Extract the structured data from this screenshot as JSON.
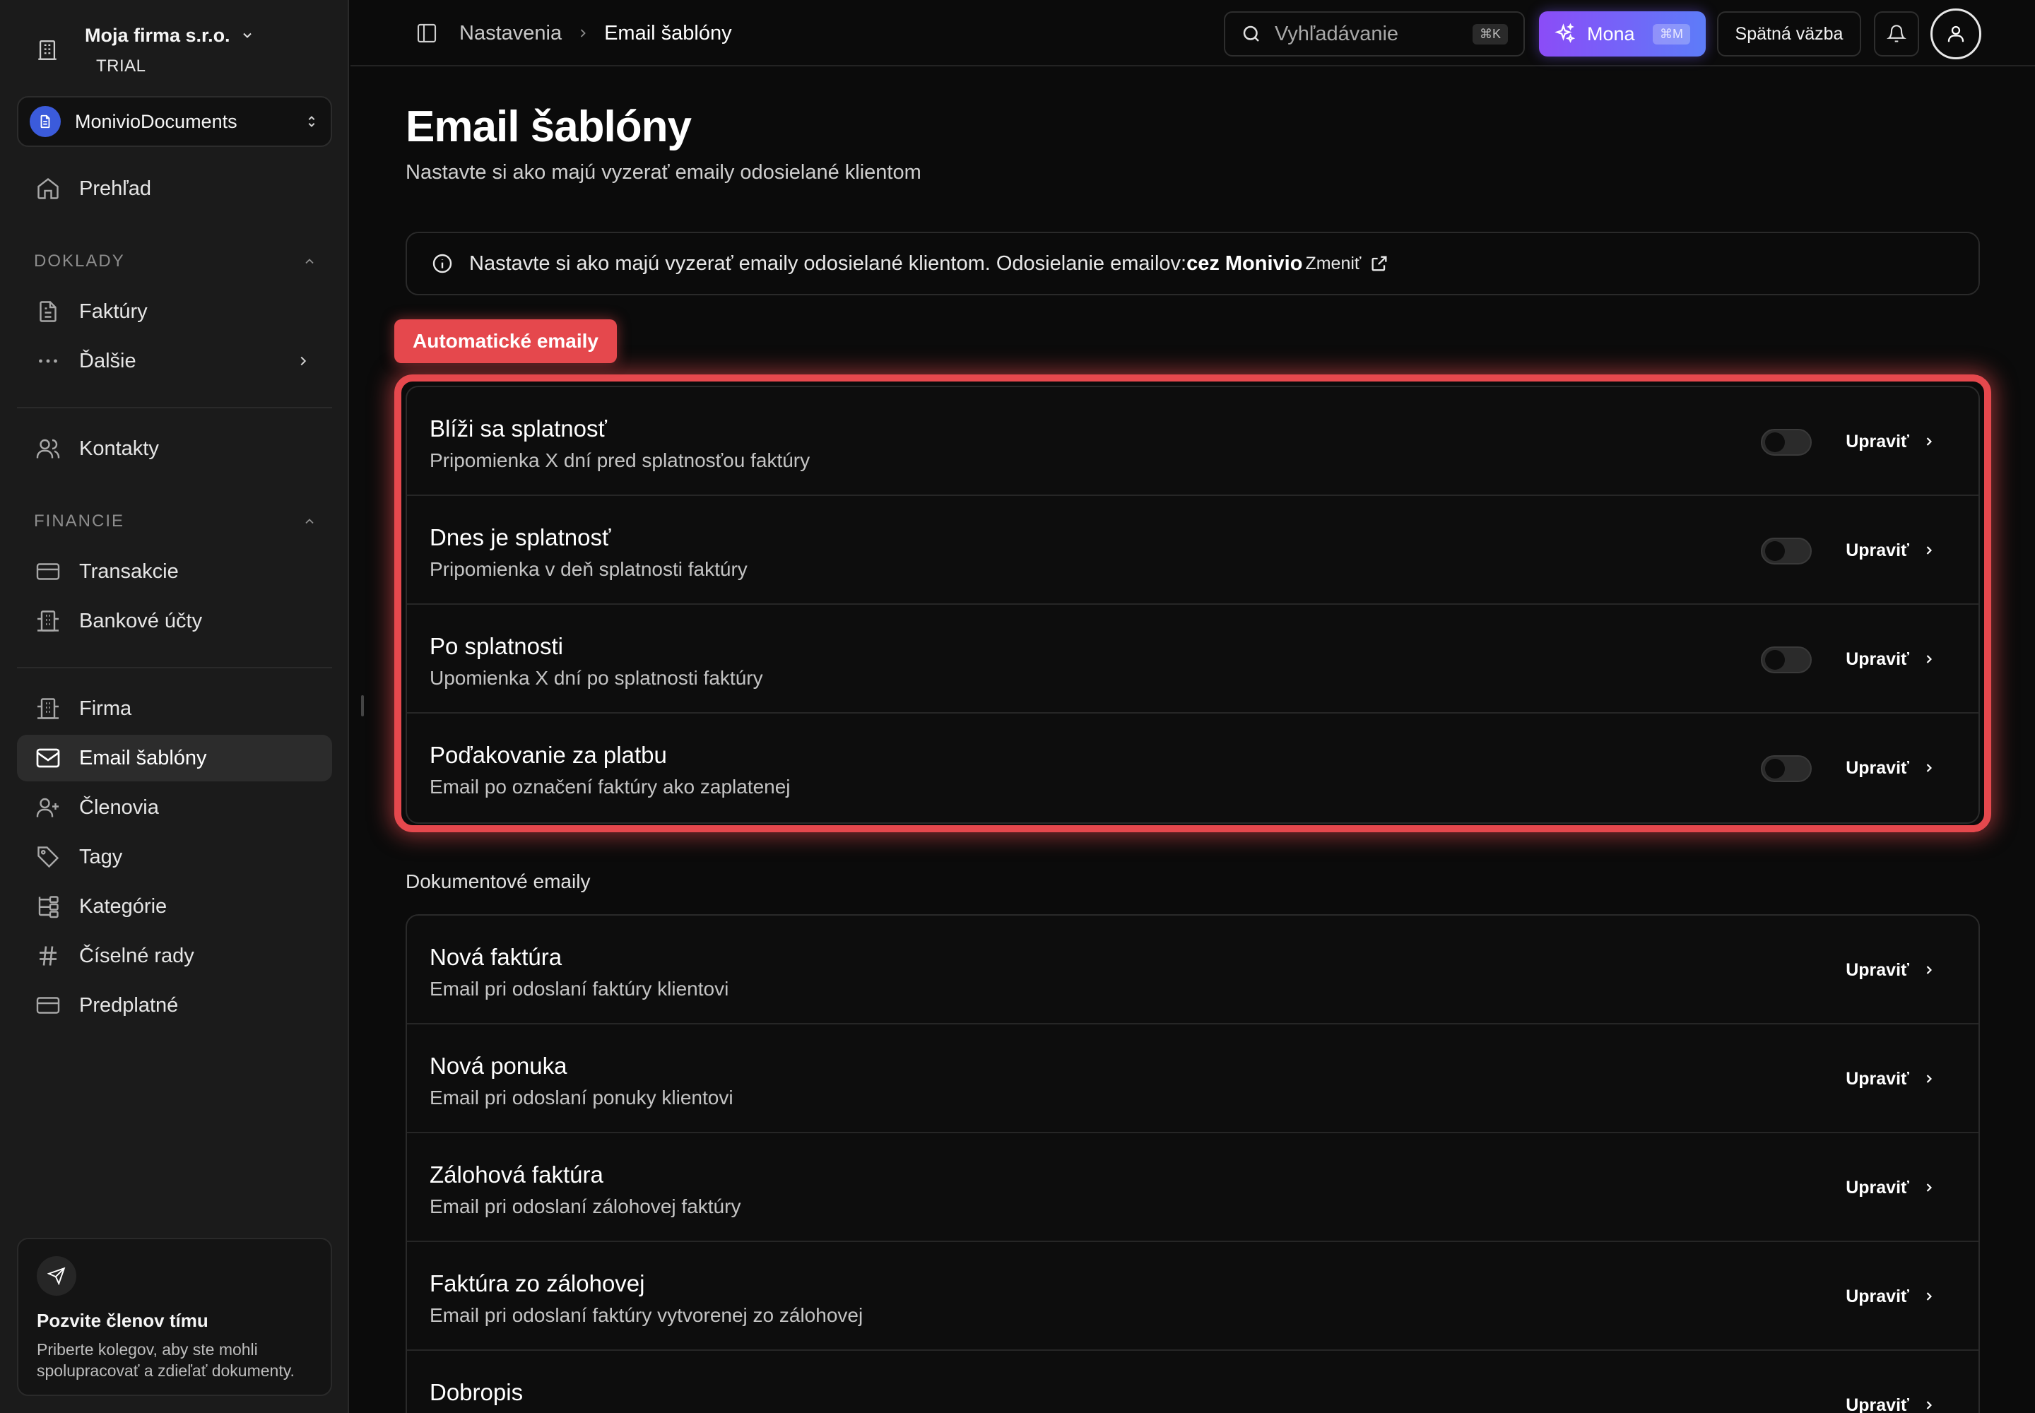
{
  "sidebar": {
    "company_name": "Moja firma s.r.o.",
    "plan": "TRIAL",
    "workspace": "MonivioDocuments",
    "overview": "Prehľad",
    "section_documents": "DOKLADY",
    "invoices": "Faktúry",
    "more": "Ďalšie",
    "contacts": "Kontakty",
    "section_finance": "FINANCIE",
    "transactions": "Transakcie",
    "bank_accounts": "Bankové účty",
    "company": "Firma",
    "email_templates": "Email šablóny",
    "members": "Členovia",
    "tags": "Tagy",
    "categories": "Kategórie",
    "number_series": "Číselné rady",
    "subscription": "Predplatné",
    "invite_title": "Pozvite členov tímu",
    "invite_desc": "Priberte kolegov, aby ste mohli spolupracovať a zdieľať dokumenty."
  },
  "topbar": {
    "breadcrumb_parent": "Nastavenia",
    "breadcrumb_current": "Email šablóny",
    "search_placeholder": "Vyhľadávanie",
    "search_shortcut": "⌘K",
    "mona_label": "Mona",
    "mona_shortcut": "⌘M",
    "feedback": "Spätná väzba"
  },
  "main": {
    "title": "Email šablóny",
    "subtitle": "Nastavte si ako majú vyzerať emaily odosielané klientom",
    "info_text": "Nastavte si ako majú vyzerať emaily odosielané klientom. Odosielanie emailov: ",
    "info_provider": "cez Monivio",
    "info_change": "Zmeniť",
    "auto_group": "Automatické emaily",
    "auto_rows": [
      {
        "title": "Blíži sa splatnosť",
        "desc": "Pripomienka X dní pred splatnosťou faktúry",
        "enabled": false,
        "action": "Upraviť"
      },
      {
        "title": "Dnes je splatnosť",
        "desc": "Pripomienka v deň splatnosti faktúry",
        "enabled": false,
        "action": "Upraviť"
      },
      {
        "title": "Po splatnosti",
        "desc": "Upomienka X dní po splatnosti faktúry",
        "enabled": false,
        "action": "Upraviť"
      },
      {
        "title": "Poďakovanie za platbu",
        "desc": "Email po označení faktúry ako zaplatenej",
        "enabled": false,
        "action": "Upraviť"
      }
    ],
    "doc_group": "Dokumentové emaily",
    "doc_rows": [
      {
        "title": "Nová faktúra",
        "desc": "Email pri odoslaní faktúry klientovi",
        "action": "Upraviť"
      },
      {
        "title": "Nová ponuka",
        "desc": "Email pri odoslaní ponuky klientovi",
        "action": "Upraviť"
      },
      {
        "title": "Zálohová faktúra",
        "desc": "Email pri odoslaní zálohovej faktúry",
        "action": "Upraviť"
      },
      {
        "title": "Faktúra zo zálohovej",
        "desc": "Email pri odoslaní faktúry vytvorenej zo zálohovej",
        "action": "Upraviť"
      },
      {
        "title": "Dobropis",
        "desc": "",
        "action": "Upraviť"
      }
    ]
  },
  "colors": {
    "accent_red": "#e5484d",
    "mona_gradient_start": "#8b4cf7",
    "mona_gradient_end": "#5d7cf9",
    "workspace_blue": "#3b5bdb"
  }
}
